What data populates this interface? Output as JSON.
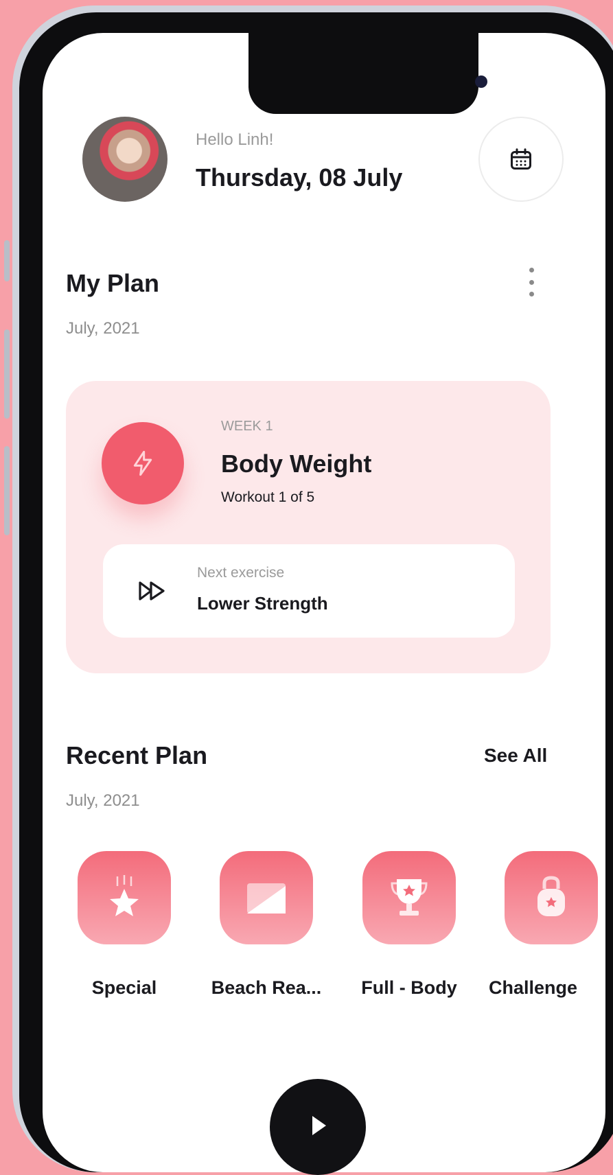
{
  "colors": {
    "background": "#f7a0a8",
    "accent": "#f15c6d",
    "card": "#fde8ea",
    "text": "#1a1a1f",
    "muted": "#9a9a9a"
  },
  "header": {
    "greeting": "Hello Linh!",
    "date": "Thursday, 08 July",
    "calendar_icon": "calendar-icon"
  },
  "my_plan": {
    "title": "My Plan",
    "subtitle": "July, 2021",
    "menu_icon": "more-vertical-icon",
    "card": {
      "week": "WEEK 1",
      "name": "Body Weight",
      "progress": "Workout 1 of 5",
      "icon": "lightning-icon",
      "next_label": "Next exercise",
      "next_name": "Lower Strength",
      "next_icon": "fast-forward-icon"
    }
  },
  "recent_plan": {
    "title": "Recent Plan",
    "subtitle": "July, 2021",
    "see_all": "See All",
    "items": [
      {
        "label": "Special",
        "icon": "star-icon"
      },
      {
        "label": "Beach Rea...",
        "icon": "beach-icon"
      },
      {
        "label": "Full - Body",
        "icon": "trophy-icon"
      },
      {
        "label": "Challenge",
        "icon": "kettlebell-icon"
      }
    ]
  },
  "bottom": {
    "play_icon": "play-icon"
  }
}
